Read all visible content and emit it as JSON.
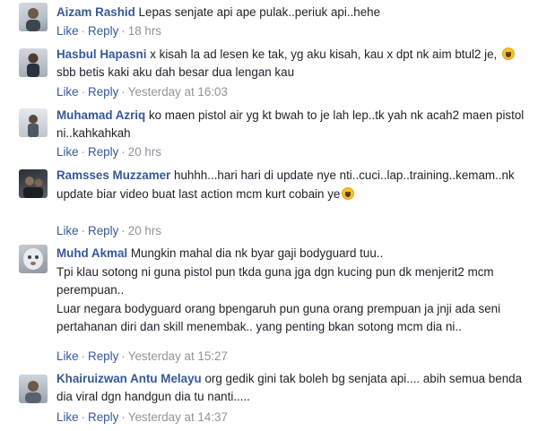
{
  "comments": [
    {
      "author": "Aizam Rashid",
      "text": "Lepas senjate api ape pulak..periuk api..hehe",
      "like": "Like",
      "reply": "Reply",
      "time": "18 hrs"
    },
    {
      "author": "Hasbul Hapasni",
      "text": "x kisah la ad lesen ke tak, yg aku kisah, kau x dpt nk aim btul2 je, ",
      "text2": " sbb betis kaki aku dah besar dua lengan kau",
      "emoji": "rofl-emoji",
      "like": "Like",
      "reply": "Reply",
      "time": "Yesterday at 16:03"
    },
    {
      "author": "Muhamad Azriq",
      "text": "ko maen pistol air yg kt bwah to je lah lep..tk yah nk acah2 maen pistol ni..kahkahkah",
      "like": "Like",
      "reply": "Reply",
      "time": "20 hrs"
    },
    {
      "author": "Ramsses Muzzamer",
      "text": "huhhh...hari hari di update nye nti..cuci..lap..training..kemam..nk update biar video buat last action mcm kurt cobain ye",
      "emoji": "laughing-emoji",
      "like": "Like",
      "reply": "Reply",
      "time": "20 hrs"
    },
    {
      "author": "Muhd Akmal",
      "text": "Mungkin mahal dia nk byar gaji bodyguard tuu..",
      "text2": "Tpi klau sotong ni guna pistol pun tkda guna jga dgn kucing pun dk menjerit2 mcm perempuan..",
      "text3": "Luar negara bodyguard orang bpengaruh pun guna orang prempuan ja jnji ada seni pertahanan diri dan skill menembak.. yang penting bkan sotong mcm dia ni..",
      "like": "Like",
      "reply": "Reply",
      "time": "Yesterday at 15:27"
    },
    {
      "author": "Khairuizwan Antu Melayu",
      "text": "org gedik gini tak boleh bg senjata api.... abih semua benda dia viral dgn handgun dia tu nanti.....",
      "like": "Like",
      "reply": "Reply",
      "time": "Yesterday at 14:37"
    }
  ],
  "separator": "·"
}
